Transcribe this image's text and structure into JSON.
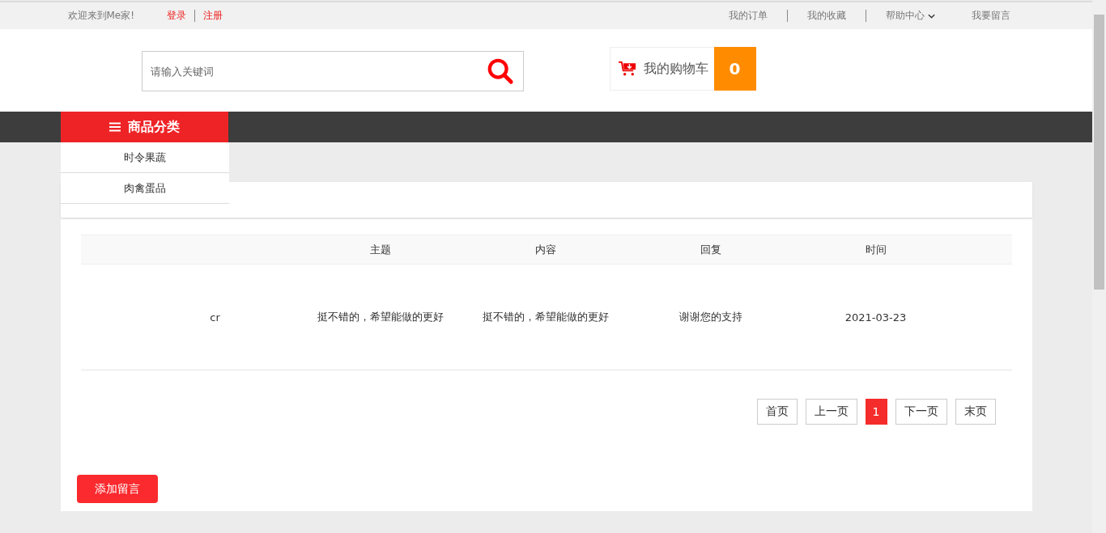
{
  "top_bar": {
    "welcome": "欢迎来到Me家!",
    "auth_links": [
      "登录",
      "注册"
    ],
    "links": [
      {
        "label": "我的订单",
        "kind": "link"
      },
      {
        "label": "我的收藏",
        "kind": "link"
      },
      {
        "label": "帮助中心",
        "kind": "dropdown"
      },
      {
        "label": "我要留言",
        "kind": "link"
      }
    ]
  },
  "search": {
    "placeholder": "请输入关键词"
  },
  "cart": {
    "label": "我的购物车",
    "count": "0"
  },
  "category_menu": {
    "title": "商品分类",
    "items": [
      "时令果蔬",
      "肉禽蛋品"
    ]
  },
  "table": {
    "columns": [
      "",
      "主题",
      "内容",
      "回复",
      "时间"
    ],
    "rows": [
      [
        "cr",
        "挺不错的，希望能做的更好",
        "挺不错的，希望能做的更好",
        "谢谢您的支持",
        "2021-03-23"
      ]
    ]
  },
  "pagination": [
    {
      "label": "首页",
      "selected": false
    },
    {
      "label": "上一页",
      "selected": false
    },
    {
      "label": "1",
      "selected": true
    },
    {
      "label": "下一页",
      "selected": false
    },
    {
      "label": "末页",
      "selected": false
    }
  ],
  "add_button": "添加留言"
}
